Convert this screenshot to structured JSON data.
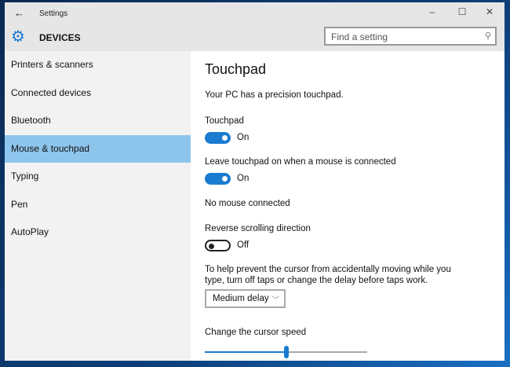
{
  "window": {
    "title": "Settings",
    "back_icon": "back-arrow-icon"
  },
  "header": {
    "title": "DEVICES",
    "search_placeholder": "Find a setting"
  },
  "sidebar": {
    "items": [
      {
        "label": "Printers & scanners"
      },
      {
        "label": "Connected devices"
      },
      {
        "label": "Bluetooth"
      },
      {
        "label": "Mouse & touchpad",
        "selected": true
      },
      {
        "label": "Typing"
      },
      {
        "label": "Pen"
      },
      {
        "label": "AutoPlay"
      }
    ]
  },
  "main": {
    "title": "Touchpad",
    "precision_text": "Your PC has a precision touchpad.",
    "touchpad_label": "Touchpad",
    "touchpad_state": "On",
    "leave_on_label": "Leave touchpad on when a mouse is connected",
    "leave_on_state": "On",
    "no_mouse": "No mouse connected",
    "reverse_label": "Reverse scrolling direction",
    "reverse_state": "Off",
    "delay_help_line1": "To help prevent the cursor from accidentally moving while you",
    "delay_help_line2": "type, turn off taps or change the delay before taps work.",
    "delay_value": "Medium delay",
    "cursor_speed_label": "Change the cursor speed",
    "cursor_speed_fraction": 0.5
  },
  "colors": {
    "accent": "#1a7bd0",
    "selected": "#8ec5ec"
  }
}
